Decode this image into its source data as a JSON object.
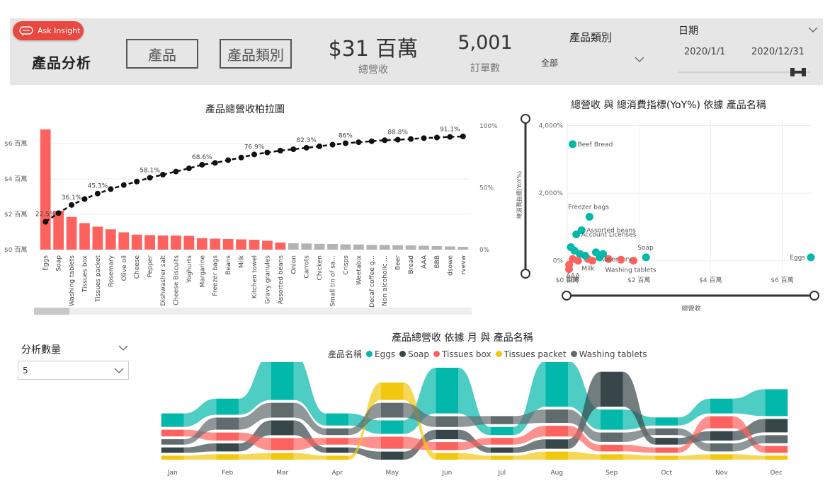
{
  "header": {
    "ask_insight": "Ask Insight",
    "title": "產品分析",
    "nav": [
      "產品",
      "產品類別"
    ],
    "kpis": [
      {
        "value": "$31 百萬",
        "label": "總營收"
      },
      {
        "value": "5,001",
        "label": "訂單數"
      }
    ],
    "category_slicer": {
      "title": "產品類別",
      "value": "全部"
    },
    "date_slicer": {
      "title": "日期",
      "start": "2020/1/1",
      "end": "2020/12/31"
    }
  },
  "analysis_slicer": {
    "title": "分析數量",
    "value": "5"
  },
  "colors": {
    "accent": "#e8483f",
    "bar_top": "#fd625e",
    "bar_rest": "#b3b3b3",
    "teal": "#01b8aa",
    "dark": "#374649",
    "red": "#fd625e",
    "yellow": "#f2c80f",
    "gray": "#5f6b6d"
  },
  "chart_data": [
    {
      "type": "bar",
      "title": "產品總營收柏拉圖",
      "categories": [
        "Eggs",
        "Soap",
        "Washing tablets",
        "Tissues box",
        "Tissues packet",
        "Rosemary",
        "Olive oil",
        "Cheese",
        "Pepper",
        "Dishwasher salt",
        "Cheese Biscuits",
        "Yoghurts",
        "Margarine",
        "Freezer bags",
        "Beans",
        "Milk",
        "Kitchen towel",
        "Gravy granules",
        "Assorted beans",
        "Onion",
        "Carrots",
        "Chicken",
        "Small tin of sa...",
        "Crisps",
        "Weetabix",
        "Decaf coffee g...",
        "Non alcoholic ...",
        "Beer",
        "Bread",
        "AAA",
        "BBB",
        "dsowe",
        "rvevw"
      ],
      "values": [
        6.8,
        2.2,
        1.85,
        1.5,
        1.3,
        1.15,
        0.98,
        0.85,
        0.82,
        0.8,
        0.8,
        0.78,
        0.65,
        0.62,
        0.6,
        0.58,
        0.56,
        0.5,
        0.4,
        0.36,
        0.35,
        0.33,
        0.32,
        0.3,
        0.29,
        0.27,
        0.26,
        0.25,
        0.24,
        0.22,
        0.2,
        0.18,
        0.16
      ],
      "highlight_count": 19,
      "cumulative_pct": [
        22.5,
        29.5,
        36.1,
        40.9,
        45.3,
        48.9,
        52.2,
        55.0,
        58.1,
        60.6,
        63.1,
        65.7,
        68.6,
        70.1,
        72.3,
        74.4,
        76.9,
        78.5,
        80.0,
        81.1,
        82.3,
        83.5,
        84.8,
        86.0,
        86.8,
        87.6,
        88.4,
        88.8,
        89.4,
        90.1,
        90.6,
        91.1,
        91.5
      ],
      "labeled_points": [
        0,
        2,
        4,
        8,
        12,
        16,
        20,
        23,
        27,
        31
      ],
      "y_ticks": [
        "$0 百萬",
        "$2 百萬",
        "$4 百萬",
        "$6 百萬"
      ],
      "y2_ticks": [
        "0%",
        "50%",
        "100%"
      ],
      "ylim": [
        0,
        7.0
      ]
    },
    {
      "type": "scatter",
      "title": "總營收 與 總消費指標(YoY%) 依據 產品名稱",
      "xlabel": "總營收",
      "ylabel": "總消費指標(YoY%)",
      "x_ticks": [
        "$0 百萬",
        "$2 百萬",
        "$4 百萬",
        "$6 百萬"
      ],
      "y_ticks": [
        "0%",
        "2,000%",
        "4,000%"
      ],
      "xlim": [
        0,
        6.8
      ],
      "ylim": [
        -300,
        4200
      ],
      "points": [
        {
          "name": "Beef Bread",
          "x": 0.15,
          "y": 3450,
          "color": "#01b8aa",
          "label": true
        },
        {
          "name": "Freezer bags",
          "x": 0.62,
          "y": 1300,
          "color": "#01b8aa",
          "label": true
        },
        {
          "name": "Assorted beans",
          "x": 0.4,
          "y": 900,
          "color": "#01b8aa",
          "label": true
        },
        {
          "name": "Account Licenses",
          "x": 0.25,
          "y": 780,
          "color": "#01b8aa",
          "label": true
        },
        {
          "name": "Soap",
          "x": 2.2,
          "y": 100,
          "color": "#01b8aa",
          "label": true
        },
        {
          "name": "Eggs",
          "x": 6.8,
          "y": 100,
          "color": "#01b8aa",
          "label": true
        },
        {
          "name": "Milk",
          "x": 0.58,
          "y": 50,
          "color": "#fd625e",
          "label": true
        },
        {
          "name": "Washing tablets",
          "x": 1.85,
          "y": 0,
          "color": "#fd625e",
          "label": true
        },
        {
          "name": "Rosemary",
          "x": 1.15,
          "y": 50,
          "color": "#fd625e",
          "label": true
        },
        {
          "name": "AAA",
          "x": 0.05,
          "y": -120,
          "color": "#fd625e",
          "label": true
        },
        {
          "name": "BBB",
          "x": 0.05,
          "y": -250,
          "color": "#fd625e",
          "label": true
        },
        {
          "name": "",
          "x": 0.1,
          "y": 400,
          "color": "#01b8aa",
          "label": false
        },
        {
          "name": "",
          "x": 0.2,
          "y": 300,
          "color": "#01b8aa",
          "label": false
        },
        {
          "name": "",
          "x": 0.35,
          "y": 200,
          "color": "#01b8aa",
          "label": false
        },
        {
          "name": "",
          "x": 0.5,
          "y": 150,
          "color": "#01b8aa",
          "label": false
        },
        {
          "name": "",
          "x": 0.8,
          "y": 250,
          "color": "#01b8aa",
          "label": false
        },
        {
          "name": "",
          "x": 0.9,
          "y": 100,
          "color": "#01b8aa",
          "label": false
        },
        {
          "name": "",
          "x": 1.0,
          "y": 200,
          "color": "#01b8aa",
          "label": false
        },
        {
          "name": "",
          "x": 0.3,
          "y": 0,
          "color": "#fd625e",
          "label": false
        },
        {
          "name": "",
          "x": 0.15,
          "y": 50,
          "color": "#fd625e",
          "label": false
        },
        {
          "name": "",
          "x": 0.7,
          "y": 0,
          "color": "#fd625e",
          "label": false
        },
        {
          "name": "",
          "x": 1.5,
          "y": 30,
          "color": "#fd625e",
          "label": false
        }
      ]
    },
    {
      "type": "area",
      "subtype": "ribbon",
      "title": "產品總營收 依據 月 與 產品名稱",
      "legend_title": "產品名稱",
      "categories": [
        "Jan",
        "Feb",
        "Mar",
        "Apr",
        "May",
        "Jun",
        "Jul",
        "Aug",
        "Sep",
        "Oct",
        "Nov",
        "Dec"
      ],
      "series": [
        {
          "name": "Eggs",
          "color": "#01b8aa",
          "values": [
            1.0,
            1.2,
            3.4,
            0.9,
            1.0,
            3.4,
            0.6,
            3.4,
            1.5,
            0.6,
            1.1,
            2.0
          ]
        },
        {
          "name": "Soap",
          "color": "#374649",
          "values": [
            0.4,
            0.6,
            1.1,
            0.4,
            0.6,
            0.7,
            0.4,
            0.7,
            2.6,
            0.5,
            0.7,
            1.0
          ]
        },
        {
          "name": "Tissues box",
          "color": "#fd625e",
          "values": [
            0.5,
            0.6,
            0.9,
            0.5,
            0.9,
            0.6,
            0.5,
            0.8,
            0.5,
            0.4,
            0.9,
            0.5
          ]
        },
        {
          "name": "Tissues packet",
          "color": "#f2c80f",
          "values": [
            0.3,
            0.4,
            0.5,
            0.3,
            1.3,
            0.5,
            0.3,
            0.6,
            0.4,
            0.3,
            0.4,
            0.3
          ]
        },
        {
          "name": "Washing tablets",
          "color": "#5f6b6d",
          "values": [
            0.4,
            0.9,
            1.1,
            0.5,
            1.1,
            0.8,
            0.6,
            1.0,
            0.7,
            0.5,
            0.6,
            0.6
          ]
        }
      ]
    }
  ]
}
